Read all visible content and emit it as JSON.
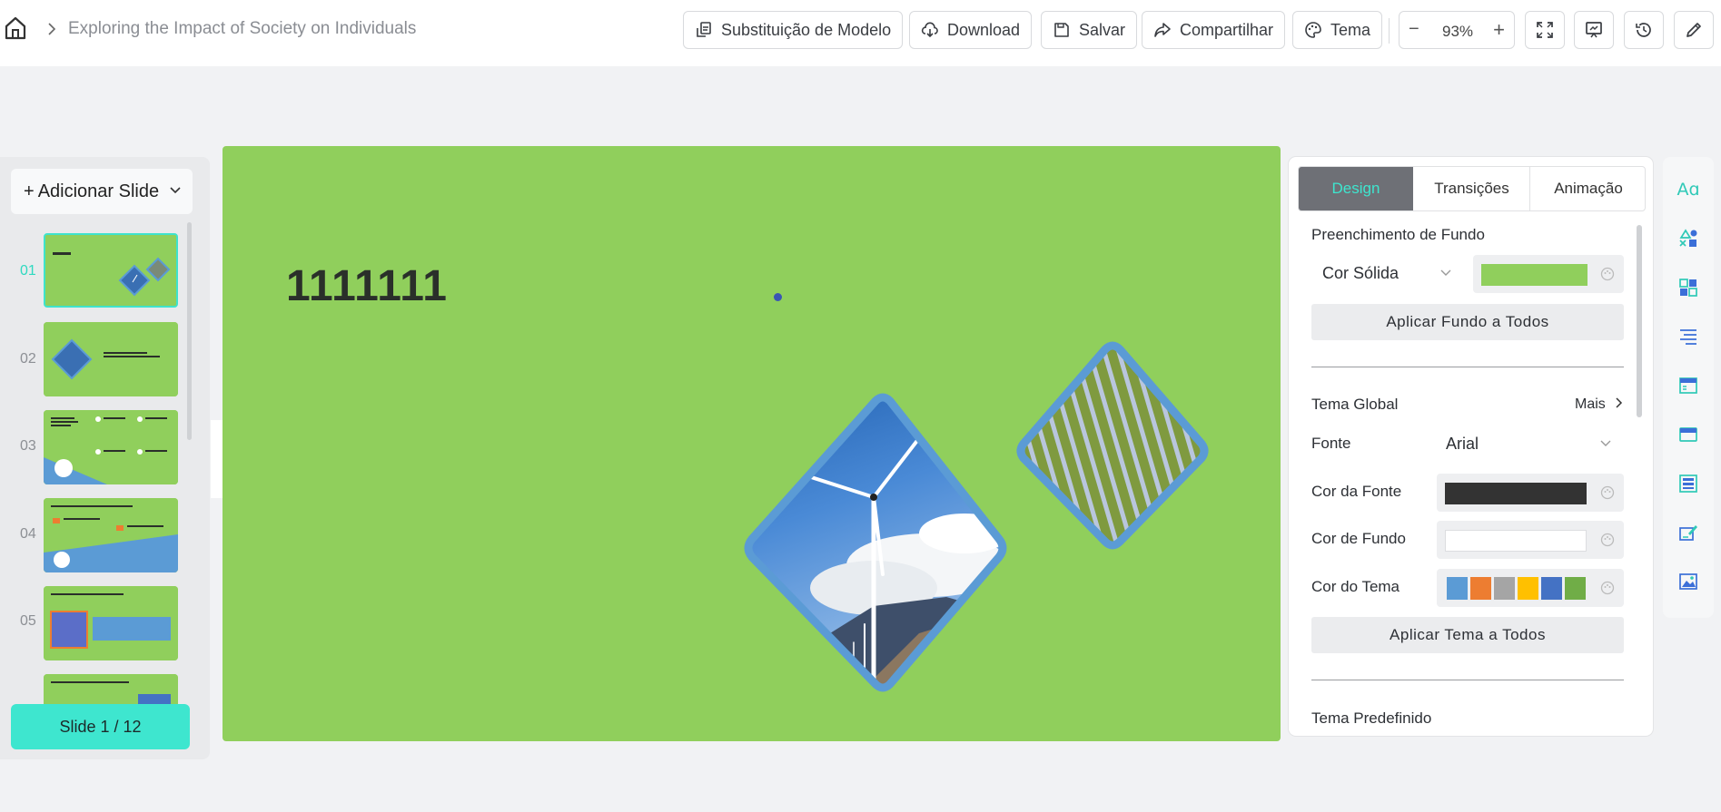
{
  "header": {
    "doc_title": "Exploring the Impact of Society on Individuals",
    "buttons": {
      "template": "Substituição de Modelo",
      "download": "Download",
      "save": "Salvar",
      "share": "Compartilhar",
      "theme": "Tema"
    },
    "zoom": {
      "minus": "−",
      "value": "93%",
      "plus": "+"
    }
  },
  "left_panel": {
    "add_slide_plus": "+",
    "add_slide_label": "Adicionar Slide",
    "slide_numbers": [
      "01",
      "02",
      "03",
      "04",
      "05"
    ],
    "slide_counter": "Slide 1 / 12"
  },
  "slide": {
    "title": "1111111"
  },
  "right_panel": {
    "tabs": [
      "Design",
      "Transições",
      "Animação"
    ],
    "background_fill_label": "Preenchimento de Fundo",
    "fill_type": "Cor Sólida",
    "apply_background_all": "Aplicar Fundo a Todos",
    "global_theme_label": "Tema Global",
    "more_label": "Mais",
    "font_label": "Fonte",
    "font_value": "Arial",
    "font_color_label": "Cor da Fonte",
    "background_color_label": "Cor de Fundo",
    "theme_color_label": "Cor do Tema",
    "apply_theme_all": "Aplicar Tema a Todos",
    "preset_theme_label": "Tema Predefinido"
  },
  "colors": {
    "slide_background": "#90cf5c",
    "accent": "#3ee6cf",
    "font_color": "#333333",
    "background_color": "#ffffff",
    "theme_palette": [
      "#5b9bd5",
      "#ed7d31",
      "#a5a5a5",
      "#ffc000",
      "#4472c4",
      "#70ad47"
    ]
  },
  "tool_strip_icons": [
    "text-style-icon",
    "shapes-icon",
    "layout-grid-icon",
    "align-icon",
    "template-icon",
    "card-icon",
    "table-icon",
    "edit-chart-icon",
    "image-icon"
  ]
}
